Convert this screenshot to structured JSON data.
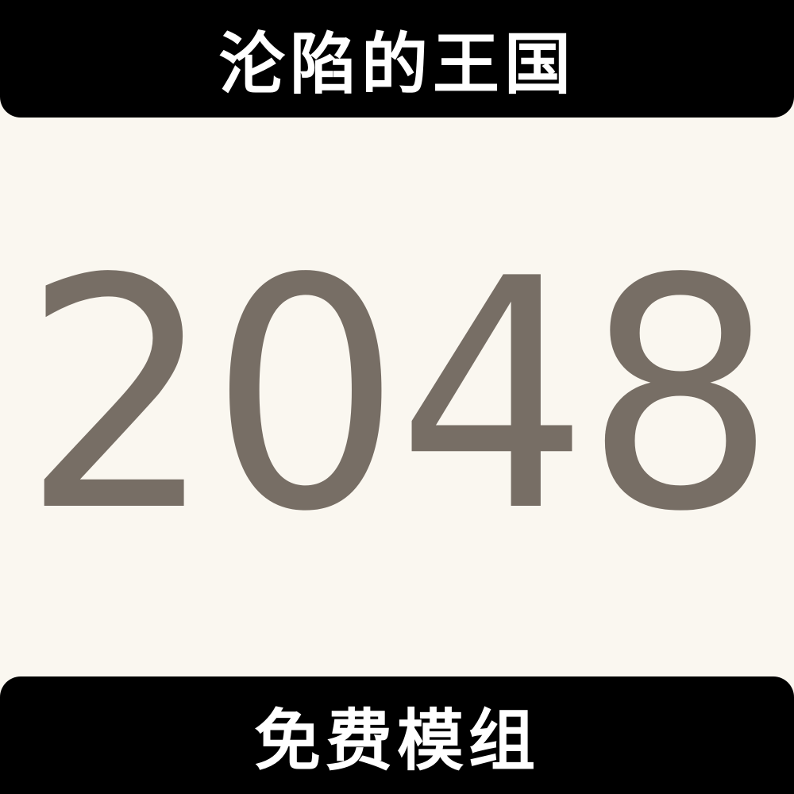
{
  "header": {
    "title": "沦陷的王国"
  },
  "tile": {
    "value": "2048"
  },
  "footer": {
    "label": "免费模组"
  },
  "colors": {
    "banner_bg": "#000000",
    "banner_text": "#ffffff",
    "tile_bg": "#faf7f0",
    "tile_text": "#776e65"
  }
}
